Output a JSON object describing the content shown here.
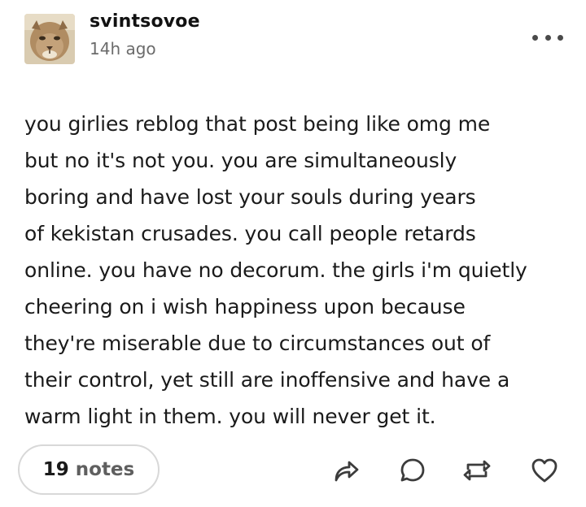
{
  "post": {
    "username": "svintsovoe",
    "timestamp": "14h ago",
    "avatar_icon": "cougar-avatar",
    "body_lines": [
      "you girlies reblog that post being like omg me",
      "but no it's not you. you are simultaneously",
      "boring and have lost your souls during years",
      "of kekistan crusades. you call people retards",
      "online. you have no decorum. the girls i'm quietly",
      "cheering on i wish happiness upon because",
      "they're miserable due to circumstances out of",
      "their control, yet still are inoffensive and have a",
      "warm light in them. you will never get it."
    ]
  },
  "footer": {
    "notes_count": "19",
    "notes_label": "notes",
    "actions": [
      "share-icon",
      "reply-icon",
      "reblog-icon",
      "like-icon"
    ]
  },
  "colors": {
    "text": "#1a1a1a",
    "muted": "#6b6b6b",
    "icon": "#3c3c3c",
    "border": "#d8d8d8"
  }
}
